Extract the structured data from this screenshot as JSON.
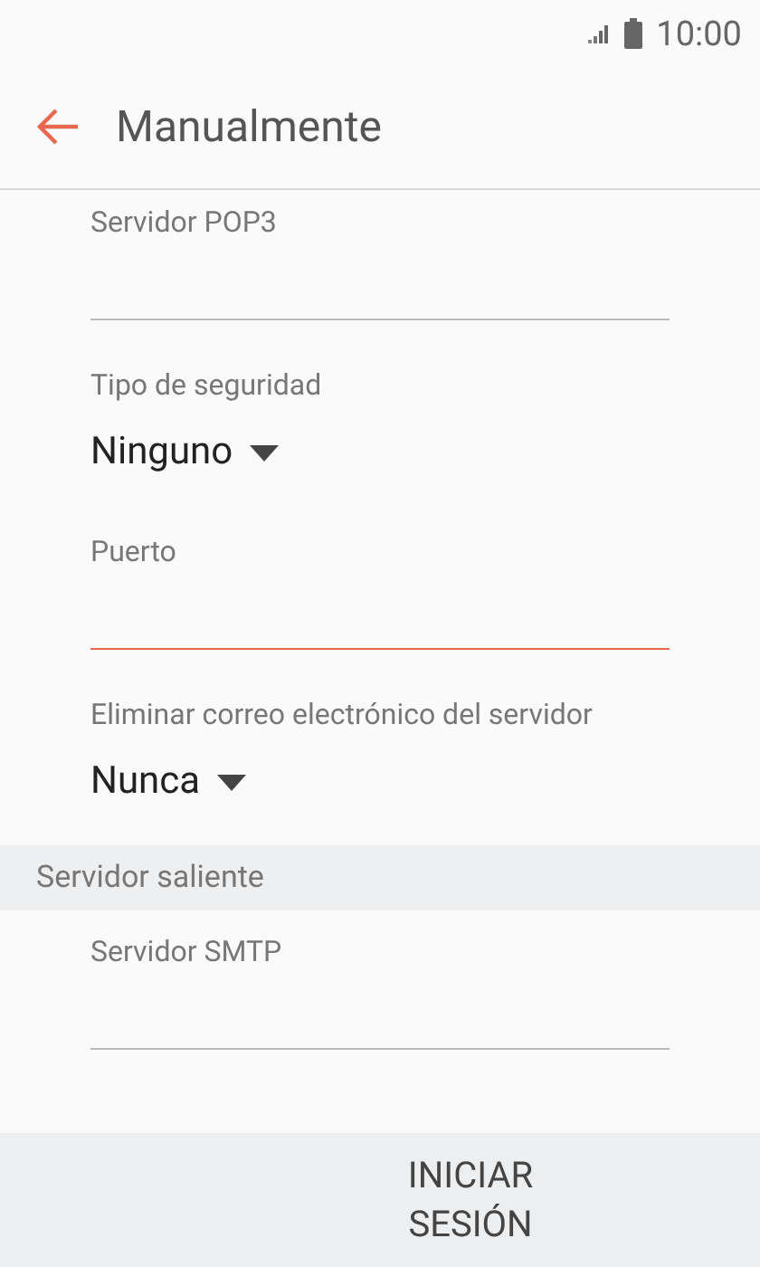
{
  "status_bar": {
    "time": "10:00"
  },
  "header": {
    "title": "Manualmente"
  },
  "fields": [
    {
      "kind": "text",
      "label": "Servidor POP3",
      "focused": false
    },
    {
      "kind": "dropdown",
      "label": "Tipo de seguridad",
      "value": "Ninguno"
    },
    {
      "kind": "text",
      "label": "Puerto",
      "focused": true
    },
    {
      "kind": "dropdown",
      "label": "Eliminar correo electrónico del servidor",
      "value": "Nunca"
    },
    {
      "kind": "section",
      "label": "Servidor saliente"
    },
    {
      "kind": "text",
      "label": "Servidor SMTP",
      "focused": false
    }
  ],
  "buttons": [
    "INICIAR SESIÓN"
  ]
}
